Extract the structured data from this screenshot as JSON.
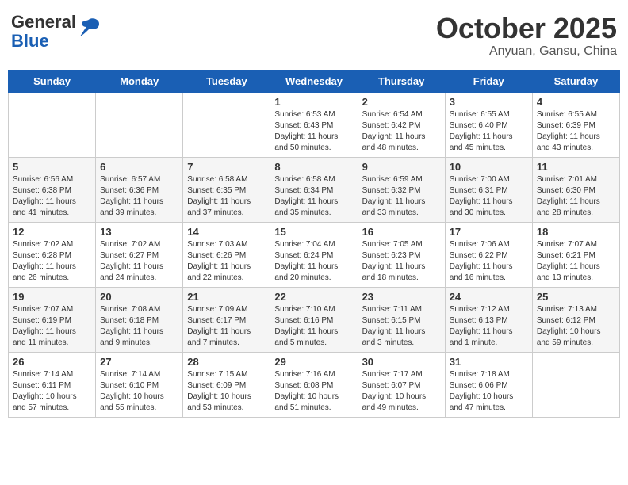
{
  "header": {
    "logo_line1": "General",
    "logo_line2": "Blue",
    "month": "October 2025",
    "location": "Anyuan, Gansu, China"
  },
  "weekdays": [
    "Sunday",
    "Monday",
    "Tuesday",
    "Wednesday",
    "Thursday",
    "Friday",
    "Saturday"
  ],
  "weeks": [
    [
      {
        "day": "",
        "info": ""
      },
      {
        "day": "",
        "info": ""
      },
      {
        "day": "",
        "info": ""
      },
      {
        "day": "1",
        "info": "Sunrise: 6:53 AM\nSunset: 6:43 PM\nDaylight: 11 hours\nand 50 minutes."
      },
      {
        "day": "2",
        "info": "Sunrise: 6:54 AM\nSunset: 6:42 PM\nDaylight: 11 hours\nand 48 minutes."
      },
      {
        "day": "3",
        "info": "Sunrise: 6:55 AM\nSunset: 6:40 PM\nDaylight: 11 hours\nand 45 minutes."
      },
      {
        "day": "4",
        "info": "Sunrise: 6:55 AM\nSunset: 6:39 PM\nDaylight: 11 hours\nand 43 minutes."
      }
    ],
    [
      {
        "day": "5",
        "info": "Sunrise: 6:56 AM\nSunset: 6:38 PM\nDaylight: 11 hours\nand 41 minutes."
      },
      {
        "day": "6",
        "info": "Sunrise: 6:57 AM\nSunset: 6:36 PM\nDaylight: 11 hours\nand 39 minutes."
      },
      {
        "day": "7",
        "info": "Sunrise: 6:58 AM\nSunset: 6:35 PM\nDaylight: 11 hours\nand 37 minutes."
      },
      {
        "day": "8",
        "info": "Sunrise: 6:58 AM\nSunset: 6:34 PM\nDaylight: 11 hours\nand 35 minutes."
      },
      {
        "day": "9",
        "info": "Sunrise: 6:59 AM\nSunset: 6:32 PM\nDaylight: 11 hours\nand 33 minutes."
      },
      {
        "day": "10",
        "info": "Sunrise: 7:00 AM\nSunset: 6:31 PM\nDaylight: 11 hours\nand 30 minutes."
      },
      {
        "day": "11",
        "info": "Sunrise: 7:01 AM\nSunset: 6:30 PM\nDaylight: 11 hours\nand 28 minutes."
      }
    ],
    [
      {
        "day": "12",
        "info": "Sunrise: 7:02 AM\nSunset: 6:28 PM\nDaylight: 11 hours\nand 26 minutes."
      },
      {
        "day": "13",
        "info": "Sunrise: 7:02 AM\nSunset: 6:27 PM\nDaylight: 11 hours\nand 24 minutes."
      },
      {
        "day": "14",
        "info": "Sunrise: 7:03 AM\nSunset: 6:26 PM\nDaylight: 11 hours\nand 22 minutes."
      },
      {
        "day": "15",
        "info": "Sunrise: 7:04 AM\nSunset: 6:24 PM\nDaylight: 11 hours\nand 20 minutes."
      },
      {
        "day": "16",
        "info": "Sunrise: 7:05 AM\nSunset: 6:23 PM\nDaylight: 11 hours\nand 18 minutes."
      },
      {
        "day": "17",
        "info": "Sunrise: 7:06 AM\nSunset: 6:22 PM\nDaylight: 11 hours\nand 16 minutes."
      },
      {
        "day": "18",
        "info": "Sunrise: 7:07 AM\nSunset: 6:21 PM\nDaylight: 11 hours\nand 13 minutes."
      }
    ],
    [
      {
        "day": "19",
        "info": "Sunrise: 7:07 AM\nSunset: 6:19 PM\nDaylight: 11 hours\nand 11 minutes."
      },
      {
        "day": "20",
        "info": "Sunrise: 7:08 AM\nSunset: 6:18 PM\nDaylight: 11 hours\nand 9 minutes."
      },
      {
        "day": "21",
        "info": "Sunrise: 7:09 AM\nSunset: 6:17 PM\nDaylight: 11 hours\nand 7 minutes."
      },
      {
        "day": "22",
        "info": "Sunrise: 7:10 AM\nSunset: 6:16 PM\nDaylight: 11 hours\nand 5 minutes."
      },
      {
        "day": "23",
        "info": "Sunrise: 7:11 AM\nSunset: 6:15 PM\nDaylight: 11 hours\nand 3 minutes."
      },
      {
        "day": "24",
        "info": "Sunrise: 7:12 AM\nSunset: 6:13 PM\nDaylight: 11 hours\nand 1 minute."
      },
      {
        "day": "25",
        "info": "Sunrise: 7:13 AM\nSunset: 6:12 PM\nDaylight: 10 hours\nand 59 minutes."
      }
    ],
    [
      {
        "day": "26",
        "info": "Sunrise: 7:14 AM\nSunset: 6:11 PM\nDaylight: 10 hours\nand 57 minutes."
      },
      {
        "day": "27",
        "info": "Sunrise: 7:14 AM\nSunset: 6:10 PM\nDaylight: 10 hours\nand 55 minutes."
      },
      {
        "day": "28",
        "info": "Sunrise: 7:15 AM\nSunset: 6:09 PM\nDaylight: 10 hours\nand 53 minutes."
      },
      {
        "day": "29",
        "info": "Sunrise: 7:16 AM\nSunset: 6:08 PM\nDaylight: 10 hours\nand 51 minutes."
      },
      {
        "day": "30",
        "info": "Sunrise: 7:17 AM\nSunset: 6:07 PM\nDaylight: 10 hours\nand 49 minutes."
      },
      {
        "day": "31",
        "info": "Sunrise: 7:18 AM\nSunset: 6:06 PM\nDaylight: 10 hours\nand 47 minutes."
      },
      {
        "day": "",
        "info": ""
      }
    ]
  ]
}
